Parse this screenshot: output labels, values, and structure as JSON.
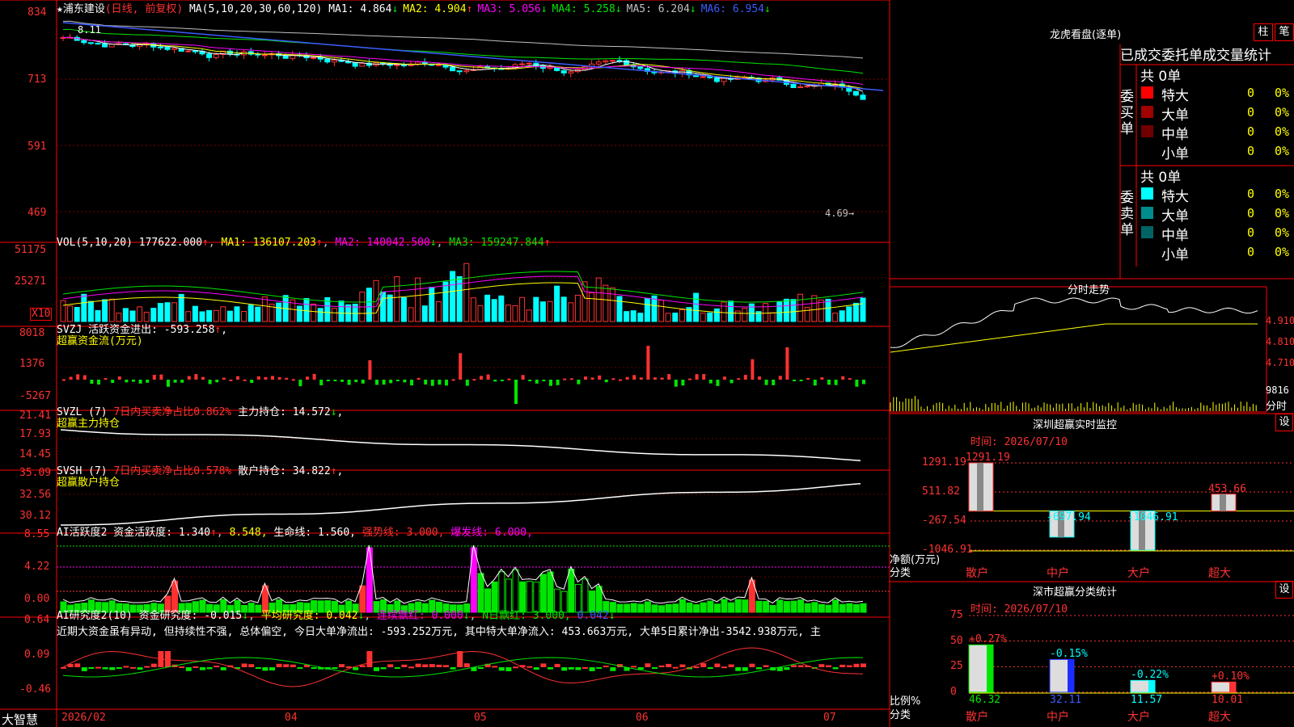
{
  "stock": {
    "star": "★",
    "name": "浦东建设",
    "period": "(日线, 前复权)"
  },
  "ma_header": {
    "label": "MA(5,10,20,30,60,120)",
    "items": [
      {
        "name": "MA1:",
        "value": "4.864",
        "arrow": "↓",
        "color": "#ffffff"
      },
      {
        "name": "MA2:",
        "value": "4.904",
        "arrow": "↑",
        "color": "#ffff00"
      },
      {
        "name": "MA3:",
        "value": "5.056",
        "arrow": "↓",
        "color": "#ff00ff"
      },
      {
        "name": "MA4:",
        "value": "5.258",
        "arrow": "↓",
        "color": "#00e600"
      },
      {
        "name": "MA5:",
        "value": "6.204",
        "arrow": "↓",
        "color": "#c0c0c0"
      },
      {
        "name": "MA6:",
        "value": "6.954",
        "arrow": "↓",
        "color": "#3c5aff"
      }
    ]
  },
  "price_axis": [
    "834",
    "713",
    "591",
    "469"
  ],
  "price_annotations": {
    "high": "8.11",
    "low": "4.69"
  },
  "vol": {
    "header": "VOL(5,10,20)",
    "value": "177622.000",
    "arrow": "↑",
    "ma1": "MA1: 136107.203",
    "ma2": "MA2: 140042.500",
    "ma3": "MA3: 159247.844",
    "axis": [
      "51175",
      "25271"
    ],
    "unit": "X10"
  },
  "svzj": {
    "title": "SVZJ  活跃资金进出: -593.258",
    "subtitle": "超赢资金流(万元)",
    "axis": [
      "8018",
      "1376",
      "-5267"
    ]
  },
  "svzl": {
    "title": "SVZL (7)",
    "ratio": "7日内买卖净占比0.862%",
    "hold": "主力持仓: 14.572",
    "subtitle": "超赢主力持仓",
    "axis": [
      "21.41",
      "17.93",
      "14.45"
    ]
  },
  "svsh": {
    "title": "SVSH (7)",
    "ratio": "7日内买卖净占比0.578%",
    "hold": "散户持仓: 34.822",
    "subtitle": "超赢散户持仓",
    "axis": [
      "35.09",
      "32.56",
      "30.12"
    ]
  },
  "ai1": {
    "title": "AI活跃度2 资金活跃度: 1.340",
    "v2": "8.548,",
    "v3": "生命线: 1.560,",
    "v4": "强势线: 3.000,",
    "v5": "爆发线: 6.000,",
    "axis": [
      "8.55",
      "4.22",
      "0.00"
    ]
  },
  "ai2": {
    "title": "AI研究度2(10) 资金研究度: -0.015",
    "v2": "平均研究度: 0.042",
    "v3": "连续飘红: 0.000",
    "v4": "N日飘红: 3.000,",
    "v5": "0.042",
    "text": "近期大资金虽有异动, 但持续性不强, 总体偏空, 今日大单净流出: -593.252万元, 其中特大单净流入: 453.663万元, 大单5日累计净出-3542.938万元, 主",
    "axis": [
      "0.64",
      "0.09",
      "-0.46"
    ]
  },
  "footer": {
    "brand": "大智慧",
    "dates": [
      "2026/02",
      "04",
      "05",
      "06",
      "07"
    ]
  },
  "dragon": {
    "title": "龙虎看盘(逐单)",
    "btn1": "柱",
    "btn2": "笔",
    "header": "已成交委托单成交量统计",
    "buy_label": "委买单",
    "sell_label": "委卖单",
    "buy_total": "共 0单",
    "sell_total": "共 0单",
    "buy_rows": [
      {
        "name": "特大",
        "count": "0",
        "pct": "0%",
        "color": "#ff0000"
      },
      {
        "name": "大单",
        "count": "0",
        "pct": "0%",
        "color": "#a00000"
      },
      {
        "name": "中单",
        "count": "0",
        "pct": "0%",
        "color": "#700000"
      },
      {
        "name": "小单",
        "count": "0",
        "pct": "0%",
        "color": ""
      }
    ],
    "sell_rows": [
      {
        "name": "特大",
        "count": "0",
        "pct": "0%",
        "color": "#00ffff"
      },
      {
        "name": "大单",
        "count": "0",
        "pct": "0%",
        "color": "#008c8c"
      },
      {
        "name": "中单",
        "count": "0",
        "pct": "0%",
        "color": "#006464"
      },
      {
        "name": "小单",
        "count": "0",
        "pct": "0%",
        "color": ""
      }
    ]
  },
  "intraday": {
    "title": "分时走势",
    "axis": [
      "4.910",
      "4.810",
      "4.710"
    ],
    "vol_label": "9816",
    "unit": "分时"
  },
  "monitor": {
    "title": "深圳超赢实时监控",
    "btn": "设",
    "time": "时间: 2026/07/10",
    "axis": [
      "1291.19",
      "511.82",
      "-267.54",
      "-1046.91"
    ],
    "ylabel": "净额(万元)",
    "xlabel_title": "分类",
    "categories": [
      "散户",
      "中户",
      "大户",
      "超大"
    ],
    "values": [
      1291.19,
      -697.94,
      -1046.91,
      453.66
    ],
    "value_labels": [
      "1291.19",
      "-697.94",
      "-1046.91",
      "453.66"
    ]
  },
  "classify": {
    "title": "深市超赢分类统计",
    "btn": "设",
    "time": "时间: 2026/07/10",
    "axis": [
      "75",
      "50",
      "25",
      "0"
    ],
    "ylabel": "比例%",
    "xlabel_title": "分类",
    "categories": [
      "散户",
      "中户",
      "大户",
      "超大"
    ],
    "values": [
      46.32,
      32.11,
      11.57,
      10.01
    ],
    "changes": [
      "+0.27%",
      "-0.15%",
      "-0.22%",
      "+0.10%"
    ]
  },
  "chart_data": [
    {
      "type": "bar",
      "title": "深圳超赢实时监控",
      "ylabel": "净额(万元)",
      "xlabel": "分类",
      "categories": [
        "散户",
        "中户",
        "大户",
        "超大"
      ],
      "values": [
        1291.19,
        -697.94,
        -1046.91,
        453.66
      ],
      "ylim": [
        -1046.91,
        1291.19
      ]
    },
    {
      "type": "bar",
      "title": "深市超赢分类统计",
      "ylabel": "比例%",
      "xlabel": "分类",
      "categories": [
        "散户",
        "中户",
        "大户",
        "超大"
      ],
      "values": [
        46.32,
        32.11,
        11.57,
        10.01
      ],
      "ylim": [
        0,
        75
      ]
    }
  ],
  "colors": {
    "up": "#ff3232",
    "down": "#00ffff",
    "grid": "#c00000",
    "panel_border": "#ff0000"
  }
}
